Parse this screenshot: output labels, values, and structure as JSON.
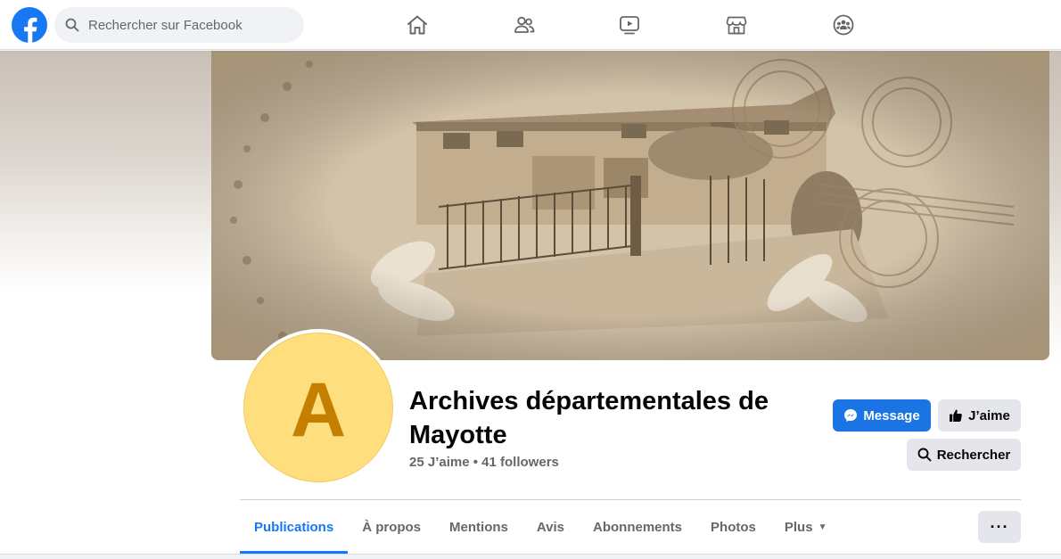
{
  "header": {
    "search_placeholder": "Rechercher sur Facebook",
    "brand_color": "#1877f2",
    "nav_icons": [
      "home-icon",
      "friends-icon",
      "watch-icon",
      "marketplace-icon",
      "groups-icon"
    ]
  },
  "page": {
    "avatar_letter": "A",
    "avatar_color": "#ffde7d",
    "title": "Archives départementales de Mayotte",
    "likes": "25 J’aime",
    "separator": "•",
    "followers": "41 followers"
  },
  "actions": {
    "message_label": "Message",
    "like_label": "J’aime",
    "search_label": "Rechercher",
    "more_label": "···"
  },
  "tabs": [
    {
      "label": "Publications",
      "active": true
    },
    {
      "label": "À propos"
    },
    {
      "label": "Mentions"
    },
    {
      "label": "Avis"
    },
    {
      "label": "Abonnements"
    },
    {
      "label": "Photos"
    },
    {
      "label": "Plus",
      "dropdown": true
    }
  ]
}
